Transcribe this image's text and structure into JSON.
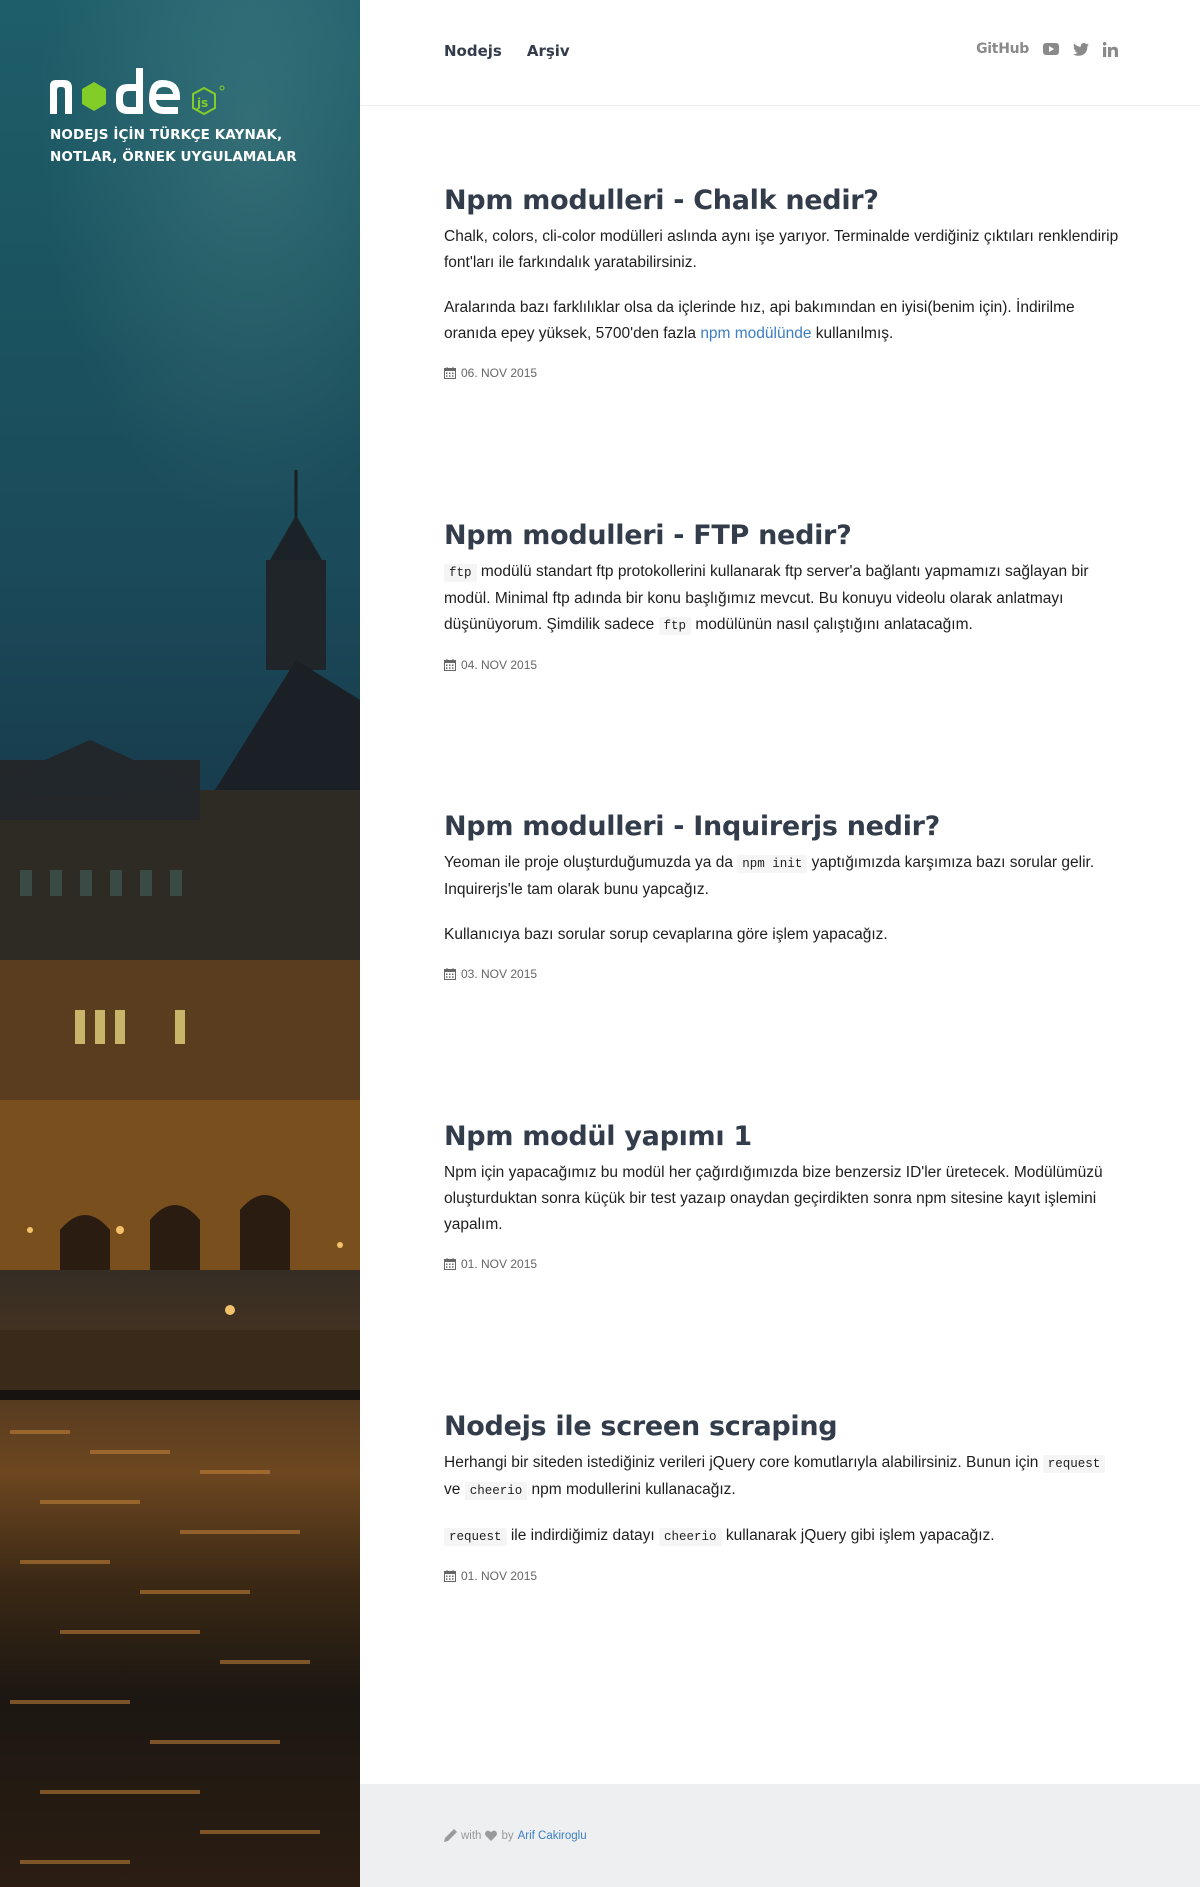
{
  "sidebar": {
    "tagline": "NODEJS İÇİN TÜRKÇE KAYNAK, NOTLAR, ÖRNEK UYGULAMALAR"
  },
  "header": {
    "nav": [
      {
        "label": "Nodejs"
      },
      {
        "label": "Arşiv"
      }
    ],
    "social": {
      "github": "GitHub",
      "icons": [
        "youtube-icon",
        "twitter-icon",
        "linkedin-icon"
      ]
    }
  },
  "posts": [
    {
      "title": "Npm modulleri - Chalk nedir?",
      "paragraphs": [
        {
          "text": "Chalk, colors, cli-color modülleri aslında aynı işe yarıyor. Terminalde verdiğiniz çıktıları renklendirip font'ları ile farkındalık yaratabilirsiniz."
        },
        {
          "pre": "Aralarında bazı farklılıklar olsa da içlerinde hız, api bakımından en iyisi(benim için). İndirilme oranıda epey yüksek, 5700'den fazla ",
          "link": "npm modülünde",
          "post": " kullanılmış."
        }
      ],
      "date": "06. NOV 2015"
    },
    {
      "title": "Npm modulleri - FTP nedir?",
      "paragraphs": [
        {
          "code1": "ftp",
          "mid": " modülü standart ftp protokollerini kullanarak ftp server'a bağlantı yapmamızı sağlayan bir modül. Minimal ftp adında bir konu başlığımız mevcut. Bu konuyu videolu olarak anlatmayı düşünüyorum. Şimdilik sadece ",
          "code2": "ftp",
          "post": " modülünün nasıl çalıştığını anlatacağım."
        }
      ],
      "date": "04. NOV 2015"
    },
    {
      "title": "Npm modulleri - Inquirerjs nedir?",
      "paragraphs": [
        {
          "pre": "Yeoman ile proje oluşturduğumuzda ya da ",
          "code": "npm init",
          "post": " yaptığımızda karşımıza bazı sorular gelir. Inquirerjs'le tam olarak bunu yapcağız."
        },
        {
          "text": "Kullanıcıya bazı sorular sorup cevaplarına göre işlem yapacağız."
        }
      ],
      "date": "03. NOV 2015"
    },
    {
      "title": "Npm modül yapımı 1",
      "paragraphs": [
        {
          "text": "Npm için yapacağımız bu modül her çağırdığımızda bize benzersiz ID'ler üretecek. Modülümüzü oluşturduktan sonra küçük bir test yazaıp onaydan geçirdikten sonra npm sitesine kayıt işlemini yapalım."
        }
      ],
      "date": "01. NOV 2015"
    },
    {
      "title": "Nodejs ile screen scraping",
      "paragraphs": [
        {
          "pre": "Herhangi bir siteden istediğiniz verileri jQuery core komutlarıyla alabilirsiniz. Bunun için ",
          "code1": "request",
          "mid": " ve ",
          "code2": "cheerio",
          "post": " npm modullerini kullanacağız."
        },
        {
          "code1": "request",
          "mid": " ile indirdiğimiz datayı ",
          "code2": "cheerio",
          "post": " kullanarak jQuery gibi işlem yapacağız."
        }
      ],
      "date": "01. NOV 2015"
    }
  ],
  "footer": {
    "with": "with",
    "by": "by",
    "author": "Arif Cakiroglu"
  },
  "colors": {
    "heading": "#333c4a",
    "link": "#3d7ec2",
    "node_green": "#83cd29"
  }
}
